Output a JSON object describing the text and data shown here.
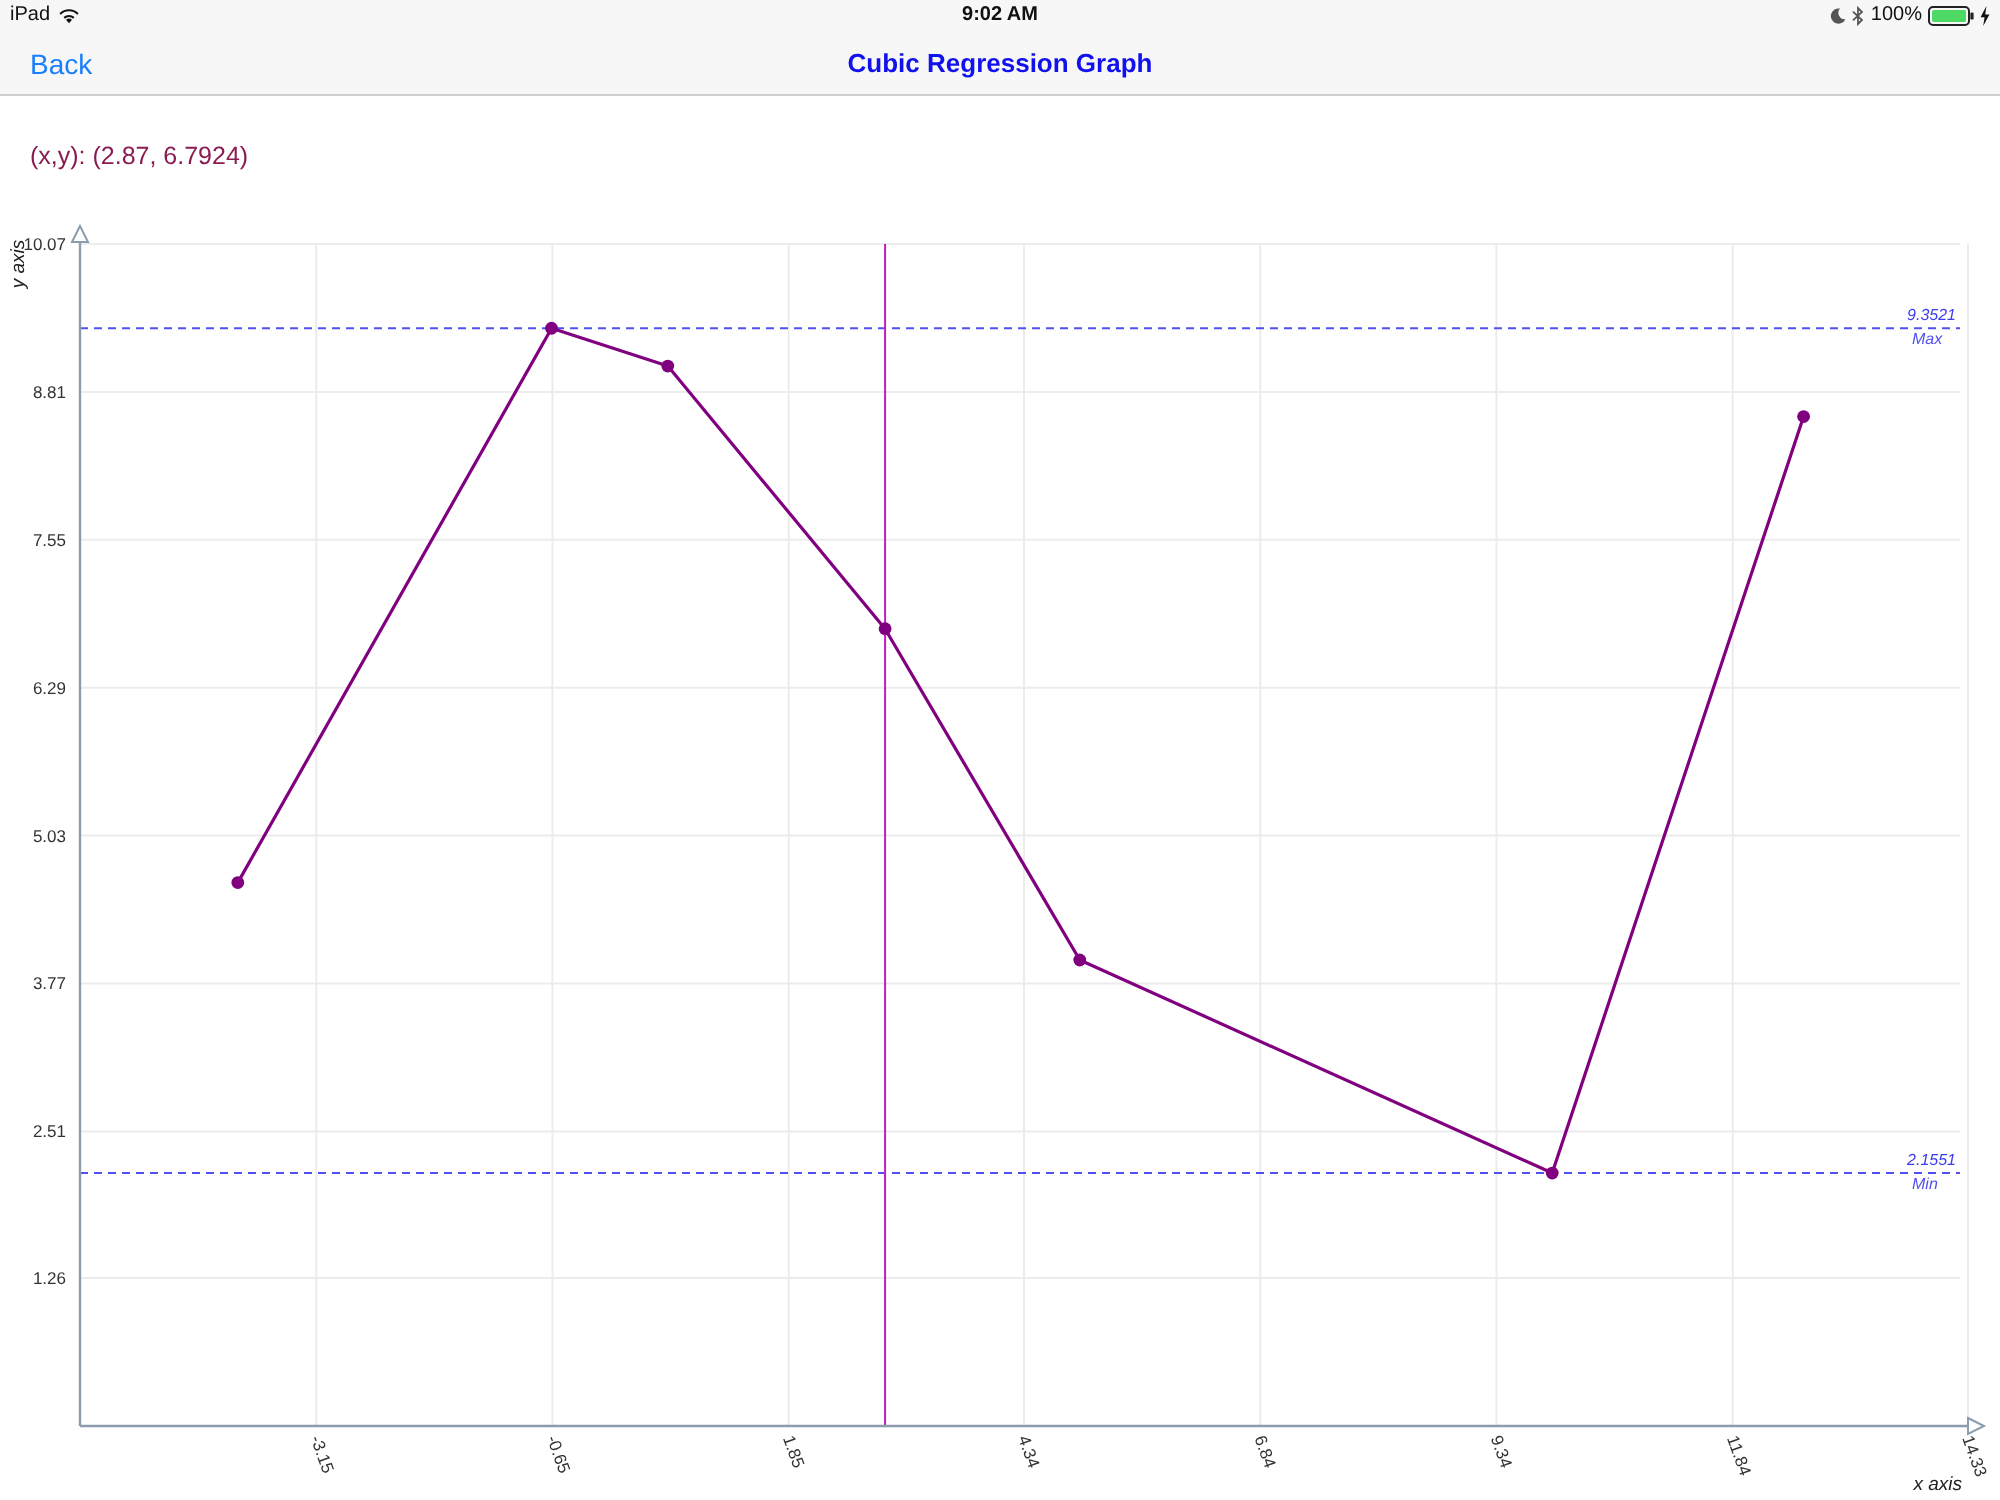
{
  "status_bar": {
    "device": "iPad",
    "time": "9:02 AM",
    "battery": "100%"
  },
  "nav_bar": {
    "back_button": "Back",
    "title": "Cubic Regression Graph"
  },
  "readout": "(x,y): (2.87, 6.7924)",
  "graph": {
    "chart_data": {
      "type": "line",
      "xlabel": "x axis",
      "ylabel": "y axis",
      "x": [
        -3.98,
        -0.66,
        0.57,
        2.87,
        4.93,
        9.93,
        12.59
      ],
      "series": [
        {
          "color": "#800080",
          "marker": "circle",
          "values": [
            4.63,
            9.3521,
            9.03,
            6.7924,
            3.97,
            2.1551,
            8.6
          ]
        }
      ],
      "xlim": [
        -5.65,
        14.33
      ],
      "ylim": [
        0,
        10.07
      ],
      "xticks": [
        -3.15,
        -0.65,
        1.85,
        4.34,
        6.84,
        9.34,
        11.84,
        14.33
      ],
      "yticks": [
        1.26,
        2.51,
        3.77,
        5.03,
        6.29,
        7.55,
        8.81,
        10.07
      ],
      "grid": true,
      "ref_lines": [
        {
          "axis": "y",
          "value": 9.3521,
          "label": "Max",
          "color": "#5050f0"
        },
        {
          "axis": "y",
          "value": 2.1551,
          "label": "Min",
          "color": "#5050f0"
        },
        {
          "axis": "x",
          "value": 2.87,
          "color": "#c21bc2"
        }
      ],
      "annotations": [
        {
          "text": "9.3521",
          "x": 14.33,
          "y": 9.3521
        },
        {
          "text": "2.1551",
          "x": 14.33,
          "y": 2.1551
        }
      ]
    }
  }
}
